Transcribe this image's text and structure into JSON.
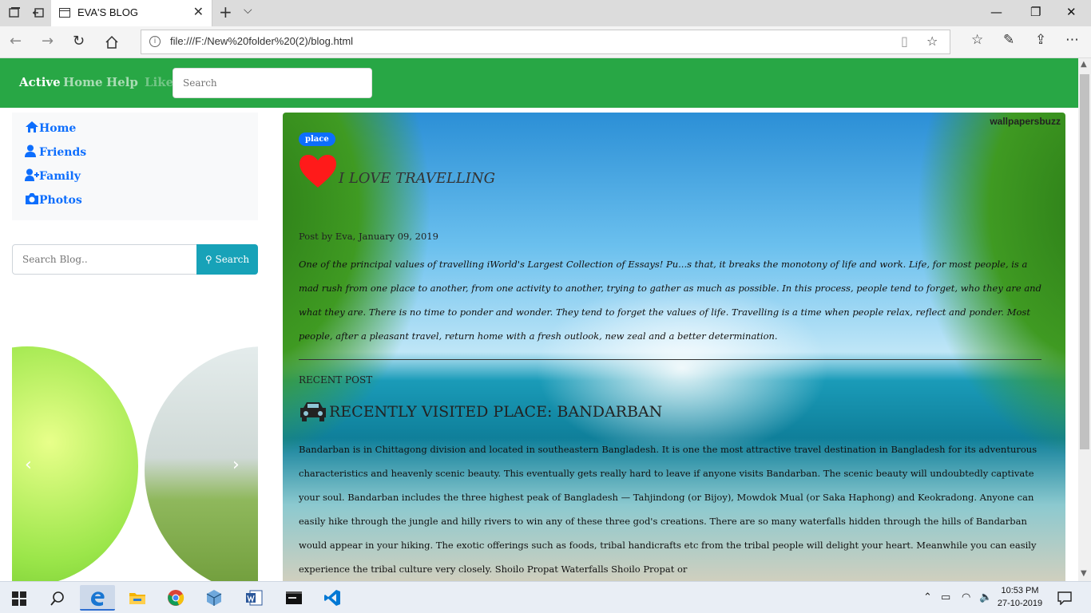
{
  "browser": {
    "tab_title": "EVA'S BLOG",
    "url": "file:///F:/New%20folder%20(2)/blog.html",
    "info_glyph": "i"
  },
  "navbar": {
    "links": [
      "Active",
      "Home",
      "Help",
      "Like"
    ],
    "search_placeholder": "Search"
  },
  "sidebar": {
    "items": [
      {
        "label": "Home",
        "icon": "home-icon"
      },
      {
        "label": "Friends",
        "icon": "user-icon"
      },
      {
        "label": "Family",
        "icon": "user-plus-icon"
      },
      {
        "label": "Photos",
        "icon": "camera-icon"
      }
    ],
    "search_placeholder": "Search Blog..",
    "search_button": "Search"
  },
  "hero": {
    "watermark": "wallpapersbuzz",
    "badge": "place",
    "title": "I LOVE TRAVELLING",
    "meta": "Post by Eva, January 09, 2019",
    "body": "One of the principal values of travelling iWorld's Largest Collection of Essays! Pu...s that, it breaks the monotony of life and work. Life, for most people, is a mad rush from one place to another, from one activity to another, trying to gather as much as possible. In this process, people tend to forget, who they are and what they are. There is no time to ponder and wonder. They tend to forget the values of life. Travelling is a time when people relax, reflect and ponder. Most people, after a pleasant travel, return home with a fresh outlook, new zeal and a better determination.",
    "recent_label": "RECENT POST",
    "recent_title": "RECENTLY VISITED PLACE: BANDARBAN",
    "recent_body": "Bandarban is in Chittagong division and located in southeastern Bangladesh. It is one the most attractive travel destination in Bangladesh for its adventurous characteristics and heavenly scenic beauty. This eventually gets really hard to leave if anyone visits Bandarban. The scenic beauty will undoubtedly captivate your soul. Bandarban includes the three highest peak of Bangladesh — Tahjindong (or Bijoy), Mowdok Mual (or Saka Haphong) and Keokradong. Anyone can easily hike through the jungle and hilly rivers to win any of these three god's creations. There are so many waterfalls hidden through the hills of Bandarban would appear in your hiking. The exotic offerings such as foods, tribal handicrafts etc from the tribal people will delight your heart. Meanwhile you can easily experience the tribal culture very closely. Shoilo Propat Waterfalls Shoilo Propat or"
  },
  "colors": {
    "navbar": "#28a745",
    "link": "#0d6efd",
    "search_button": "#17a2b8"
  },
  "taskbar": {
    "time": "10:53 PM",
    "date": "27-10-2019"
  }
}
